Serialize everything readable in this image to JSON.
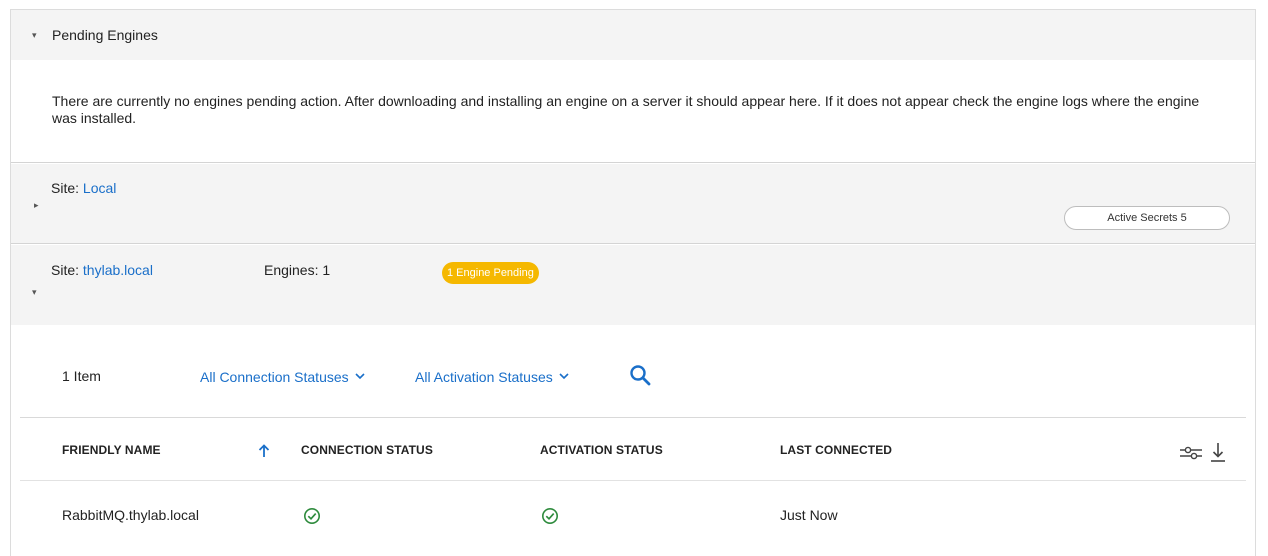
{
  "pending": {
    "title": "Pending Engines",
    "message": "There are currently no engines pending action. After downloading and installing an engine on a server it should appear here. If it does not appear check the engine logs where the engine was installed."
  },
  "sites": [
    {
      "label": "Site: ",
      "name": "Local",
      "secrets": "Active Secrets 5"
    },
    {
      "label": "Site: ",
      "name": "thylab.local",
      "engines": "Engines: 1",
      "badge": "1 Engine Pending"
    }
  ],
  "toolbar": {
    "item_count": "1 Item",
    "connection_filter": "All Connection Statuses",
    "activation_filter": "All Activation Statuses"
  },
  "table": {
    "columns": [
      "FRIENDLY NAME",
      "CONNECTION STATUS",
      "ACTIVATION STATUS",
      "LAST CONNECTED"
    ],
    "rows": [
      {
        "friendly_name": "RabbitMQ.thylab.local",
        "connection_status": "check-circle-icon",
        "activation_status": "check-circle-icon",
        "last_connected": "Just Now"
      }
    ]
  },
  "icons": {
    "search": "search-icon",
    "sort": "sort-ascending-icon",
    "settings": "column-settings-icon",
    "download": "download-icon"
  },
  "colors": {
    "link": "#1a6fc9",
    "badge": "#f5b800",
    "success": "#2e8b3d",
    "header_bg": "#f4f4f4"
  }
}
